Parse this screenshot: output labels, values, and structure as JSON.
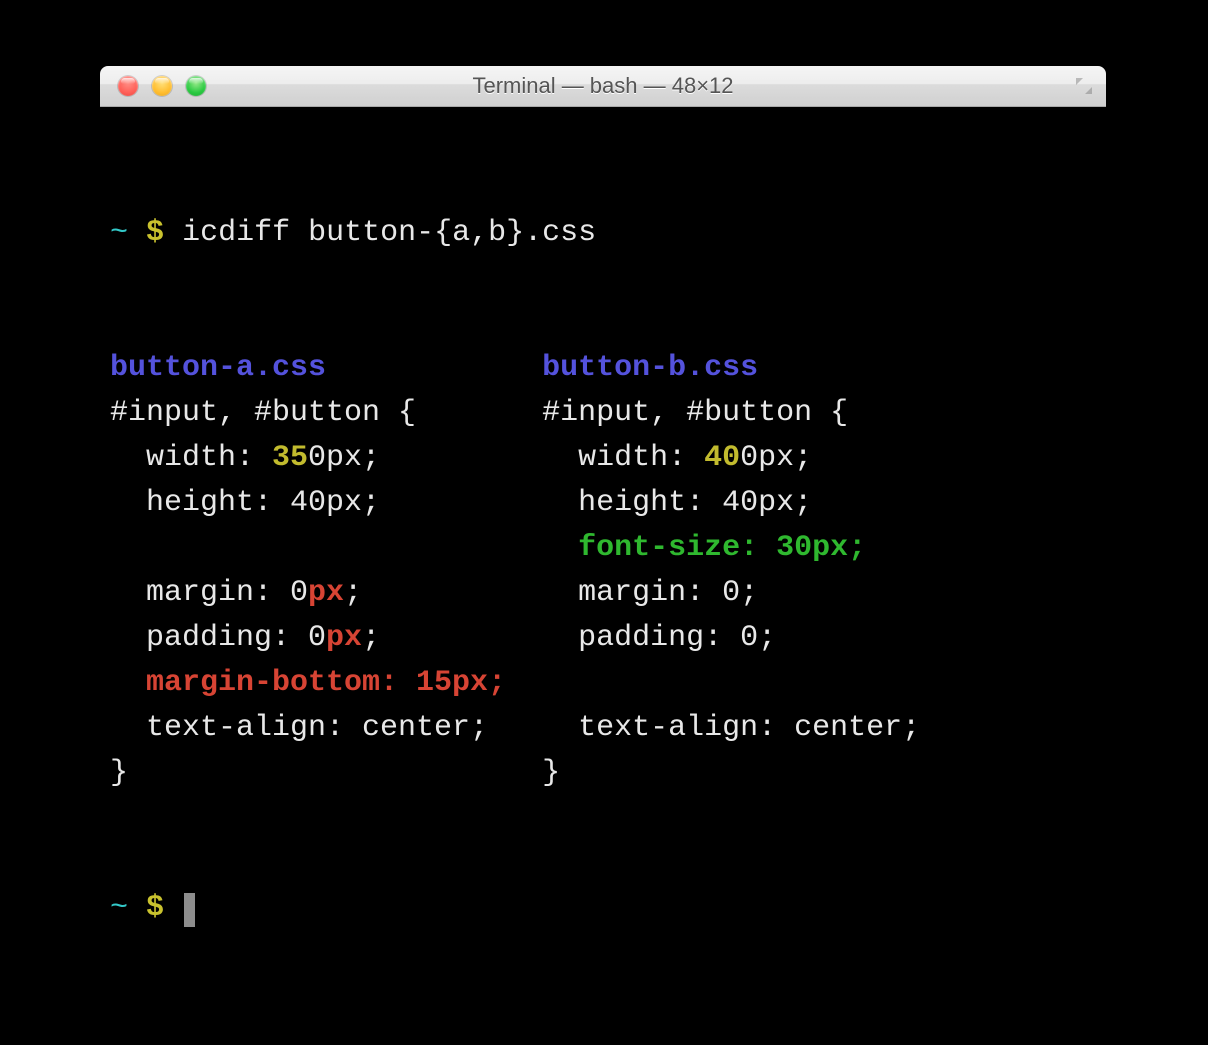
{
  "window": {
    "title": "Terminal — bash — 48×12"
  },
  "prompt": {
    "path": "~",
    "symbol": "$",
    "command": "icdiff button-{a,b}.css"
  },
  "prompt2": {
    "path": "~",
    "symbol": "$"
  },
  "left": {
    "filename": "button-a.css",
    "l0": "#input, #button {",
    "l1a": "  width: ",
    "l1b": "35",
    "l1c": "0px;",
    "l2": "  height: 40px;",
    "l3": "",
    "l4a": "  margin: 0",
    "l4b": "px",
    "l4c": ";",
    "l5a": "  padding: 0",
    "l5b": "px",
    "l5c": ";",
    "l6": "  margin-bottom: 15px;",
    "l7": "  text-align: center;",
    "l8": "}"
  },
  "right": {
    "filename": "button-b.css",
    "l0": "#input, #button {",
    "l1a": "  width: ",
    "l1b": "40",
    "l1c": "0px;",
    "l2": "  height: 40px;",
    "l3": "  font-size: 30px;",
    "l4": "  margin: 0;",
    "l5": "  padding: 0;",
    "l6": "",
    "l7": "  text-align: center;",
    "l8": "}"
  }
}
